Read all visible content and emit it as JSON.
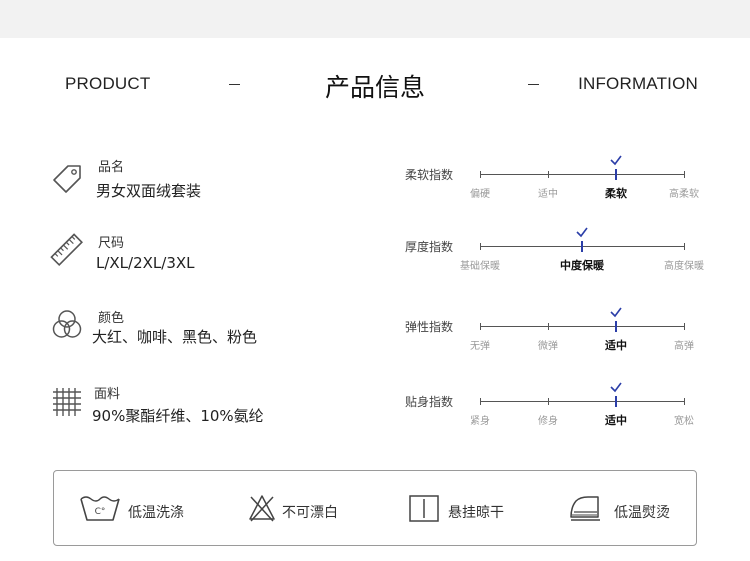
{
  "header": {
    "left": "PRODUCT",
    "title": "产品信息",
    "right": "INFORMATION"
  },
  "attributes": [
    {
      "label": "品名",
      "value": "男女双面绒套装",
      "icon": "tag-icon"
    },
    {
      "label": "尺码",
      "value": "L/XL/2XL/3XL",
      "icon": "ruler-icon"
    },
    {
      "label": "颜色",
      "value": "大红、咖啡、黑色、粉色",
      "icon": "color-circles-icon"
    },
    {
      "label": "面料",
      "value": "90%聚酯纤维、10%氨纶",
      "icon": "fabric-grid-icon"
    }
  ],
  "scales": [
    {
      "name": "柔软指数",
      "ticks": [
        "偏硬",
        "适中",
        "柔软",
        "高柔软"
      ],
      "selected": 2
    },
    {
      "name": "厚度指数",
      "ticks": [
        "基础保暖",
        "中度保暖",
        "高度保暖"
      ],
      "selected": 1
    },
    {
      "name": "弹性指数",
      "ticks": [
        "无弹",
        "微弹",
        "适中",
        "高弹"
      ],
      "selected": 2
    },
    {
      "name": "贴身指数",
      "ticks": [
        "紧身",
        "修身",
        "适中",
        "宽松"
      ],
      "selected": 2
    }
  ],
  "care": [
    {
      "label": "低温洗涤",
      "icon": "wash-30-icon",
      "icon_text": "C°"
    },
    {
      "label": "不可漂白",
      "icon": "no-bleach-icon"
    },
    {
      "label": "悬挂晾干",
      "icon": "hang-dry-icon"
    },
    {
      "label": "低温熨烫",
      "icon": "iron-low-icon"
    }
  ],
  "colors": {
    "marker": "#2b3ea8",
    "text": "#222222",
    "muted": "#9a9a9a"
  }
}
